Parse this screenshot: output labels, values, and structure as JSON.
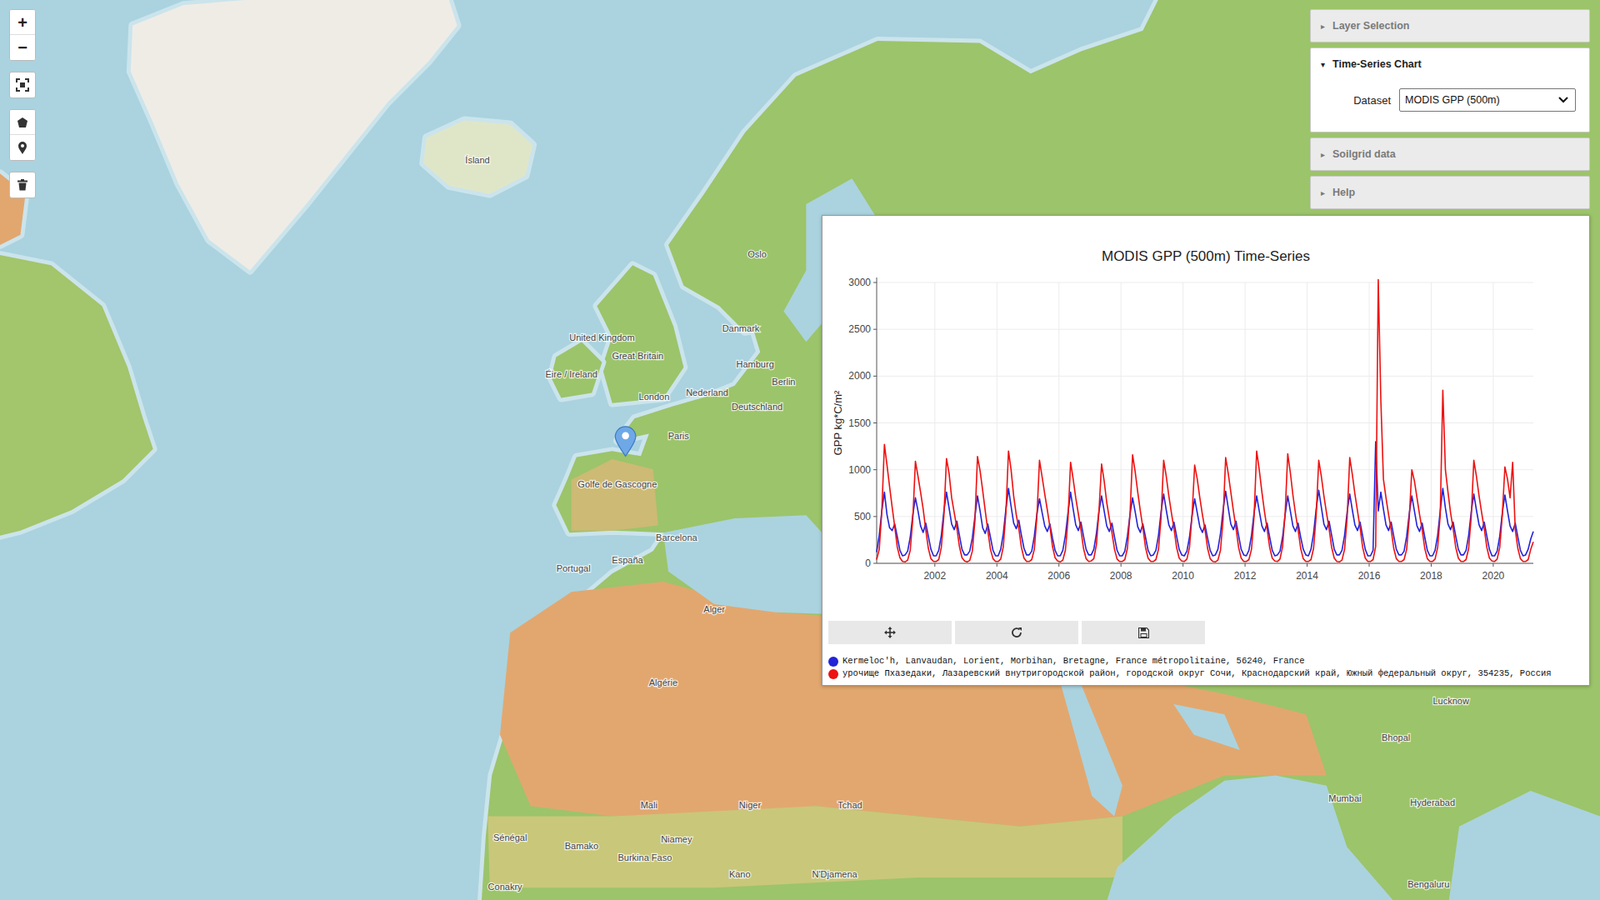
{
  "map": {
    "labels": [
      "Ísland",
      "Oslo",
      "Danmark",
      "United Kingdom",
      "Great Britain",
      "Éire / Ireland",
      "London",
      "Nederland",
      "Hamburg",
      "Berlin",
      "Deutschland",
      "Paris",
      "Golfe de Gascogne",
      "España",
      "Barcelona",
      "Portugal",
      "Alger",
      "Algérie",
      "Mali",
      "Niger",
      "Tchad",
      "Niamey",
      "Bamako",
      "Burkina Faso",
      "Kano",
      "N'Djamena",
      "Sénégal",
      "Conakry",
      "Mumbai",
      "Bhopal",
      "Hyderabad",
      "Lucknow",
      "Bengaluru"
    ]
  },
  "toolbar": {
    "zoom_in": "+",
    "zoom_out": "−"
  },
  "panel": {
    "collapsed_icon": "▸",
    "expanded_icon": "▾",
    "sections": [
      {
        "title": "Layer Selection",
        "expanded": false
      },
      {
        "title": "Time-Series Chart",
        "expanded": true,
        "body": {
          "label": "Dataset",
          "value": "MODIS GPP (500m)"
        }
      },
      {
        "title": "Soilgrid data",
        "expanded": false
      },
      {
        "title": "Help",
        "expanded": false
      }
    ]
  },
  "chart": {
    "title": "MODIS GPP (500m) Time-Series",
    "y_axis_label": "GPP kg*C/m²",
    "y_ticks": [
      "0",
      "500",
      "1000",
      "1500",
      "2000",
      "2500",
      "3000"
    ],
    "x_ticks": [
      "2002",
      "2004",
      "2006",
      "2008",
      "2010",
      "2012",
      "2014",
      "2016",
      "2018",
      "2020"
    ],
    "t0": 2000.125,
    "step": 0.083333,
    "series": [
      {
        "name": "Kermeloc'h, Lanvaudan, Lorient, Morbihan, Bretagne, France métropolitaine, 56240, France",
        "color": "#2323d8",
        "values": [
          120,
          300,
          560,
          760,
          520,
          380,
          350,
          420,
          280,
          140,
          80,
          90,
          130,
          280,
          520,
          700,
          560,
          400,
          330,
          430,
          290,
          150,
          80,
          80,
          140,
          300,
          560,
          760,
          590,
          420,
          360,
          450,
          300,
          150,
          90,
          90,
          130,
          270,
          500,
          720,
          560,
          380,
          320,
          420,
          280,
          140,
          80,
          80,
          150,
          320,
          580,
          800,
          610,
          430,
          370,
          460,
          300,
          160,
          90,
          90,
          130,
          290,
          530,
          690,
          540,
          400,
          340,
          420,
          270,
          140,
          80,
          80,
          140,
          300,
          540,
          760,
          580,
          410,
          350,
          440,
          290,
          150,
          90,
          90,
          150,
          320,
          560,
          720,
          560,
          400,
          340,
          430,
          280,
          140,
          80,
          80,
          130,
          290,
          520,
          700,
          550,
          390,
          330,
          420,
          280,
          140,
          80,
          90,
          140,
          300,
          550,
          740,
          570,
          410,
          350,
          440,
          290,
          150,
          90,
          80,
          130,
          280,
          510,
          690,
          540,
          390,
          330,
          410,
          270,
          140,
          80,
          90,
          150,
          320,
          570,
          770,
          590,
          420,
          360,
          450,
          300,
          150,
          90,
          80,
          140,
          300,
          540,
          720,
          560,
          400,
          340,
          430,
          280,
          140,
          80,
          90,
          130,
          280,
          520,
          720,
          560,
          400,
          340,
          430,
          280,
          150,
          90,
          80,
          150,
          320,
          580,
          780,
          600,
          420,
          360,
          450,
          300,
          150,
          90,
          90,
          140,
          300,
          550,
          740,
          570,
          410,
          350,
          440,
          290,
          150,
          80,
          80,
          140,
          1300,
          560,
          760,
          580,
          410,
          350,
          440,
          290,
          150,
          90,
          90,
          130,
          290,
          530,
          720,
          560,
          400,
          340,
          430,
          280,
          140,
          80,
          80,
          140,
          300,
          560,
          800,
          590,
          420,
          360,
          440,
          290,
          150,
          90,
          90,
          140,
          300,
          550,
          740,
          570,
          410,
          350,
          440,
          290,
          150,
          80,
          80,
          130,
          290,
          540,
          730,
          560,
          400,
          340,
          430,
          280,
          140,
          80,
          90,
          150,
          260,
          340
        ]
      },
      {
        "name": "урочище Пхазедаки, Лазаревский внутригородской район, городской округ Сочи, Краснодарский край, Южный федеральный округ, 354235, Россия",
        "color": "#ee1111",
        "values": [
          40,
          150,
          560,
          1270,
          1050,
          820,
          600,
          390,
          170,
          60,
          20,
          15,
          35,
          140,
          480,
          1090,
          930,
          760,
          580,
          360,
          160,
          50,
          20,
          20,
          40,
          170,
          510,
          1120,
          960,
          700,
          540,
          380,
          180,
          60,
          25,
          15,
          30,
          130,
          450,
          1140,
          990,
          780,
          560,
          350,
          150,
          50,
          20,
          20,
          45,
          180,
          540,
          1200,
          1000,
          720,
          520,
          370,
          170,
          55,
          20,
          20,
          40,
          150,
          500,
          1100,
          920,
          740,
          570,
          390,
          180,
          60,
          25,
          15,
          35,
          140,
          470,
          1080,
          900,
          700,
          530,
          360,
          160,
          50,
          20,
          25,
          50,
          200,
          560,
          1060,
          880,
          650,
          480,
          330,
          150,
          45,
          20,
          20,
          40,
          160,
          520,
          1160,
          980,
          760,
          560,
          380,
          170,
          55,
          20,
          20,
          40,
          150,
          490,
          1100,
          930,
          720,
          540,
          370,
          170,
          55,
          25,
          20,
          45,
          170,
          520,
          1050,
          900,
          700,
          520,
          360,
          160,
          50,
          20,
          15,
          35,
          140,
          470,
          1130,
          960,
          760,
          560,
          380,
          170,
          55,
          20,
          20,
          40,
          150,
          500,
          1200,
          1000,
          760,
          550,
          370,
          170,
          55,
          25,
          20,
          45,
          180,
          540,
          1170,
          970,
          730,
          530,
          360,
          160,
          50,
          20,
          20,
          40,
          160,
          510,
          1100,
          930,
          720,
          540,
          370,
          170,
          55,
          20,
          15,
          35,
          150,
          490,
          1130,
          950,
          740,
          560,
          380,
          170,
          55,
          20,
          20,
          40,
          180,
          3030,
          1750,
          900,
          700,
          520,
          360,
          160,
          50,
          20,
          20,
          40,
          150,
          480,
          1000,
          880,
          700,
          520,
          360,
          160,
          50,
          20,
          20,
          45,
          170,
          520,
          1850,
          1000,
          760,
          540,
          370,
          170,
          55,
          20,
          20,
          40,
          160,
          500,
          1100,
          930,
          720,
          540,
          370,
          170,
          55,
          25,
          20,
          45,
          170,
          520,
          1030,
          900,
          700,
          1080,
          360,
          160,
          50,
          20,
          20,
          40,
          150,
          230
        ]
      }
    ]
  }
}
